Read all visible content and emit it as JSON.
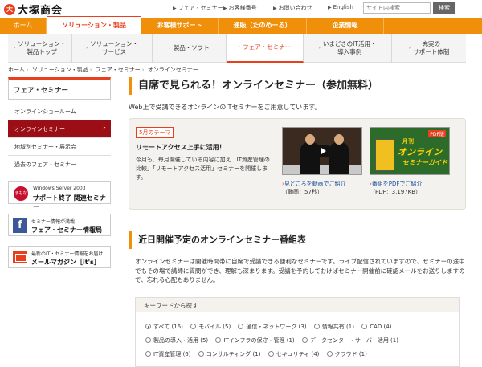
{
  "header": {
    "brand": "大塚商会",
    "brand_mark": "大",
    "utility_links": [
      "フェア・セミナー",
      "お客様番号",
      "お問い合わせ",
      "English"
    ],
    "search_placeholder": "サイト内検索",
    "search_button": "検索"
  },
  "global_nav": {
    "items": [
      "ホーム",
      "ソリューション・製品",
      "お客様サポート",
      "通販（たのめーる）",
      "企業情報"
    ],
    "active": "ソリューション・製品"
  },
  "sub_nav": {
    "items": [
      "ソリューション・\n製品トップ",
      "ソリューション・\nサービス",
      "製品・ソフト",
      "フェア・セミナー",
      "いまどきのIT活用・\n導入事例",
      "充実の\nサポート体制"
    ],
    "active": "フェア・セミナー"
  },
  "breadcrumb": [
    "ホーム",
    "ソリューション・製品",
    "フェア・セミナー",
    "オンラインセミナー"
  ],
  "sidebar": {
    "heading": "フェア・セミナー",
    "items": [
      "オンラインショールーム",
      "オンラインセミナー",
      "地域別セミナー・展示会",
      "過去のフェア・セミナー"
    ],
    "active": "オンラインセミナー",
    "banners": [
      {
        "badge": "まもなく",
        "small": "Windows Server 2003",
        "big": "サポート終了 関連セミナー"
      },
      {
        "small": "セミナー情報が満載！",
        "big": "フェア・セミナー情報局"
      },
      {
        "small": "最新のIT・セミナー情報をお届け",
        "big": "メールマガジン［it's］"
      }
    ]
  },
  "main": {
    "title": "自席で見られる！オンラインセミナー（参加無料）",
    "lead": "Web上で受講できるオンラインのITセミナーをご用意しています。",
    "feature": {
      "month_tag": "5月のテーマ",
      "title": "リモートアクセス上手に活用！",
      "desc": "今月も、毎月開催している内容に加え「IT資産管理の比較」「リモートアクセス活用」セミナーを開催します。",
      "video_link": "見どころを動画でご紹介",
      "video_meta": "（動画：57秒）",
      "pdf_link": "番組をPDFでご紹介",
      "pdf_meta": "（PDF：3,197KB）",
      "pdf_thumb": {
        "tag": "PDF版",
        "line1": "月刊",
        "line2": "オンライン",
        "line3": "セミナーガイド"
      }
    },
    "schedule": {
      "title": "近日開催予定のオンラインセミナー番組表",
      "desc": "オンラインセミナーは開催時間帯に自席で受講できる便利なセミナーです。ライブ配信されていますので、セミナーの途中でもその場で講師に質問ができ、理解も深まります。受講を予約しておけばセミナー開催前に確認メールをお送りしますので、忘れる心配もありません。",
      "keyword_heading": "キーワードから探す",
      "keyword_rows": [
        [
          {
            "label": "すべて (16)",
            "checked": true
          },
          {
            "label": "モバイル (5)"
          },
          {
            "label": "通信・ネットワーク (3)"
          },
          {
            "label": "情報共有 (1)"
          },
          {
            "label": "CAD (4)"
          }
        ],
        [
          {
            "label": "製品の導入・活用 (5)"
          },
          {
            "label": "ITインフラの保守・管理 (1)"
          },
          {
            "label": "データセンター・サーバー活用 (1)"
          }
        ],
        [
          {
            "label": "IT資産管理 (6)"
          },
          {
            "label": "コンサルティング (1)"
          },
          {
            "label": "セキュリティ (4)"
          },
          {
            "label": "クラウド (1)"
          }
        ]
      ]
    }
  }
}
